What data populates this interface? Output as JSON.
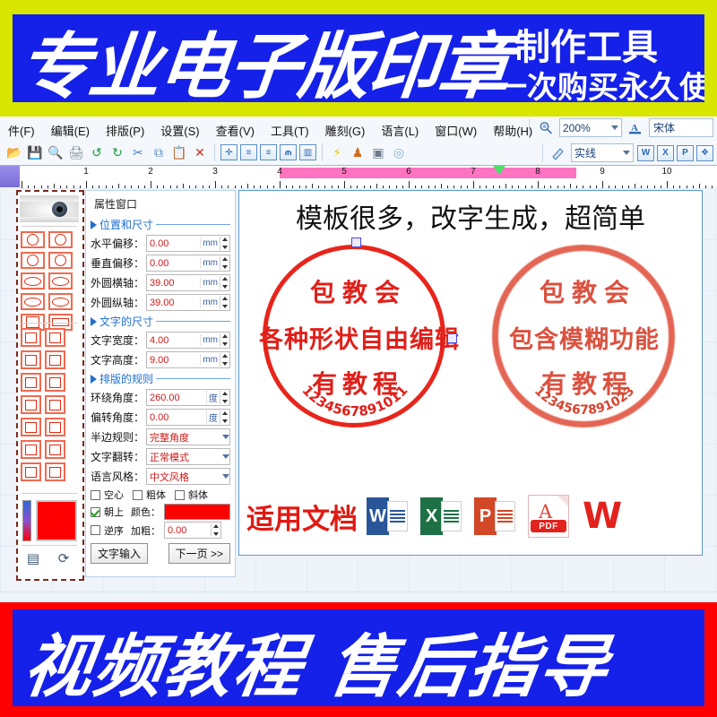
{
  "promo": {
    "top_main": "专业电子版印章",
    "top_sub1": "制作工具",
    "top_sub2": "一次购买永久使用",
    "bottom_main": "视频教程  售后指导",
    "banner_blue": "#1521e8",
    "banner_edge": "#d8e600",
    "bottom_edge": "#ff0000"
  },
  "menubar": {
    "items": [
      {
        "label": "件(F)"
      },
      {
        "label": "编辑(E)"
      },
      {
        "label": "排版(P)"
      },
      {
        "label": "设置(S)"
      },
      {
        "label": "查看(V)"
      },
      {
        "label": "工具(T)"
      },
      {
        "label": "雕刻(G)"
      },
      {
        "label": "语言(L)"
      },
      {
        "label": "窗口(W)"
      },
      {
        "label": "帮助(H)"
      }
    ],
    "zoom_icon": "zoom-tool-icon",
    "zoom_value": "200%",
    "font_icon": "font-color-icon",
    "font_value": "宋体"
  },
  "toolbar": {
    "left_icons": [
      {
        "name": "open-file-icon",
        "glyph": "📂"
      },
      {
        "name": "save-icon",
        "glyph": "💾"
      },
      {
        "name": "print-preview-icon",
        "glyph": "🔍"
      },
      {
        "name": "print-icon",
        "glyph": "🖨"
      },
      {
        "name": "undo-icon",
        "glyph": "↺"
      },
      {
        "name": "redo-icon",
        "glyph": "↻"
      },
      {
        "name": "cut-icon",
        "glyph": "✂"
      },
      {
        "name": "copy-icon",
        "glyph": "⧉"
      },
      {
        "name": "paste-icon",
        "glyph": "📋"
      },
      {
        "name": "delete-icon",
        "glyph": "✕"
      }
    ],
    "align_icons": [
      {
        "name": "align-center-icon",
        "glyph": "✛"
      },
      {
        "name": "align-left-icon",
        "glyph": "≡"
      },
      {
        "name": "align-right-icon",
        "glyph": "≡"
      },
      {
        "name": "distribute-icon",
        "glyph": "⫙"
      },
      {
        "name": "chart-icon",
        "glyph": "▥"
      }
    ],
    "extra_icons": [
      {
        "name": "lightning-icon",
        "glyph": "⚡"
      },
      {
        "name": "engrave-icon",
        "glyph": "♟"
      },
      {
        "name": "camera-icon",
        "glyph": "▣"
      },
      {
        "name": "disc-icon",
        "glyph": "◎"
      }
    ],
    "line_icon": "line-style-icon",
    "line_value": "实线",
    "export_icons": [
      {
        "name": "export-word-icon",
        "glyph": "W"
      },
      {
        "name": "export-excel-icon",
        "glyph": "X"
      },
      {
        "name": "export-ppt-icon",
        "glyph": "P"
      },
      {
        "name": "export-wps-icon",
        "glyph": "❖"
      }
    ]
  },
  "ruler": {
    "numbers": [
      "1",
      "2",
      "3",
      "4",
      "5",
      "6",
      "7",
      "8",
      "9",
      "10"
    ],
    "band_color": "#ff74c0",
    "band_start": 4,
    "band_end": 8.6,
    "marker_at": 7.4
  },
  "palette": {
    "eye_preview": "eye-preview-image",
    "shapes": [
      {
        "name": "circle-star-shape"
      },
      {
        "name": "circle-square-shape"
      },
      {
        "name": "circle-bar-shape"
      },
      {
        "name": "circle-double-bar-shape"
      },
      {
        "name": "ellipse-arrow-shape"
      },
      {
        "name": "ellipse-dotted-shape"
      },
      {
        "name": "ellipse-bar-shape"
      },
      {
        "name": "ellipse-line-shape"
      },
      {
        "name": "grid-square-shape"
      },
      {
        "name": "grid-wide-shape"
      },
      {
        "name": "square-frame-shape"
      },
      {
        "name": "square-split-shape"
      },
      {
        "name": "diamond-shape"
      },
      {
        "name": "triangle-down-shape"
      },
      {
        "name": "quad-square-shape"
      },
      {
        "name": "quad-split-shape"
      },
      {
        "name": "panel-left-shape"
      },
      {
        "name": "panel-top-shape"
      },
      {
        "name": "panel-bottom-shape"
      },
      {
        "name": "panel-vertical-shape"
      },
      {
        "name": "bar-single-shape"
      },
      {
        "name": "bar-double-shape"
      },
      {
        "name": "bar-triple-shape"
      },
      {
        "name": "bar-quad-shape"
      }
    ],
    "gradient_bar": "gradient-bar",
    "current_color": "#ff0000",
    "bottom_buttons": [
      {
        "name": "card-icon",
        "glyph": "▤"
      },
      {
        "name": "refresh-icon",
        "glyph": "⟳"
      }
    ]
  },
  "props": {
    "title": "属性窗口",
    "sections": [
      {
        "label": "位置和尺寸"
      },
      {
        "label": "文字的尺寸"
      },
      {
        "label": "排版的规则"
      }
    ],
    "position_fields": [
      {
        "label": "水平偏移：",
        "value": "0.00",
        "unit": "mm"
      },
      {
        "label": "垂直偏移：",
        "value": "0.00",
        "unit": "mm"
      },
      {
        "label": "外圆横轴：",
        "value": "39.00",
        "unit": "mm"
      },
      {
        "label": "外圆纵轴：",
        "value": "39.00",
        "unit": "mm"
      }
    ],
    "text_fields": [
      {
        "label": "文字宽度：",
        "value": "4.00",
        "unit": "mm"
      },
      {
        "label": "文字高度：",
        "value": "9.00",
        "unit": "mm"
      }
    ],
    "layout_fields": [
      {
        "label": "环绕角度：",
        "value": "260.00",
        "unit": "度"
      },
      {
        "label": "偏转角度：",
        "value": "0.00",
        "unit": "度"
      }
    ],
    "selects": [
      {
        "label": "半边规则：",
        "value": "完整角度"
      },
      {
        "label": "文字翻转：",
        "value": "正常模式"
      },
      {
        "label": "语言风格：",
        "value": "中文风格"
      }
    ],
    "checkboxes": [
      {
        "label": "空心",
        "checked": false
      },
      {
        "label": "粗体",
        "checked": false
      },
      {
        "label": "斜体",
        "checked": false
      },
      {
        "label": "朝上",
        "checked": true
      },
      {
        "label": "逆序",
        "checked": false
      }
    ],
    "color_label": "颜色：",
    "color_value": "#ff0000",
    "bold_label": "加粗：",
    "bold_value": "0.00",
    "buttons": [
      {
        "label": "文字输入"
      },
      {
        "label": "下一页 >>"
      }
    ]
  },
  "canvas": {
    "headline": "模板很多，改字生成，超简单",
    "stamp_left": {
      "line1": "包教会",
      "line2": "各种形状自由编辑",
      "line3": "有教程",
      "arc_text": "1234567891011",
      "color": "#e0201a"
    },
    "stamp_right": {
      "line1": "包教会",
      "line2": "包含模糊功能",
      "line3": "有教程",
      "arc_text": "1234567891023",
      "color": "#d8432f"
    },
    "docs_label": "适用文档",
    "docs": [
      {
        "name": "word-icon",
        "letter": "W",
        "color": "#2a5699"
      },
      {
        "name": "excel-icon",
        "letter": "X",
        "color": "#1e7145"
      },
      {
        "name": "powerpoint-icon",
        "letter": "P",
        "color": "#d24726"
      },
      {
        "name": "pdf-icon",
        "letter": "A",
        "badge": "PDF"
      },
      {
        "name": "wps-icon",
        "letter": "W"
      }
    ]
  }
}
